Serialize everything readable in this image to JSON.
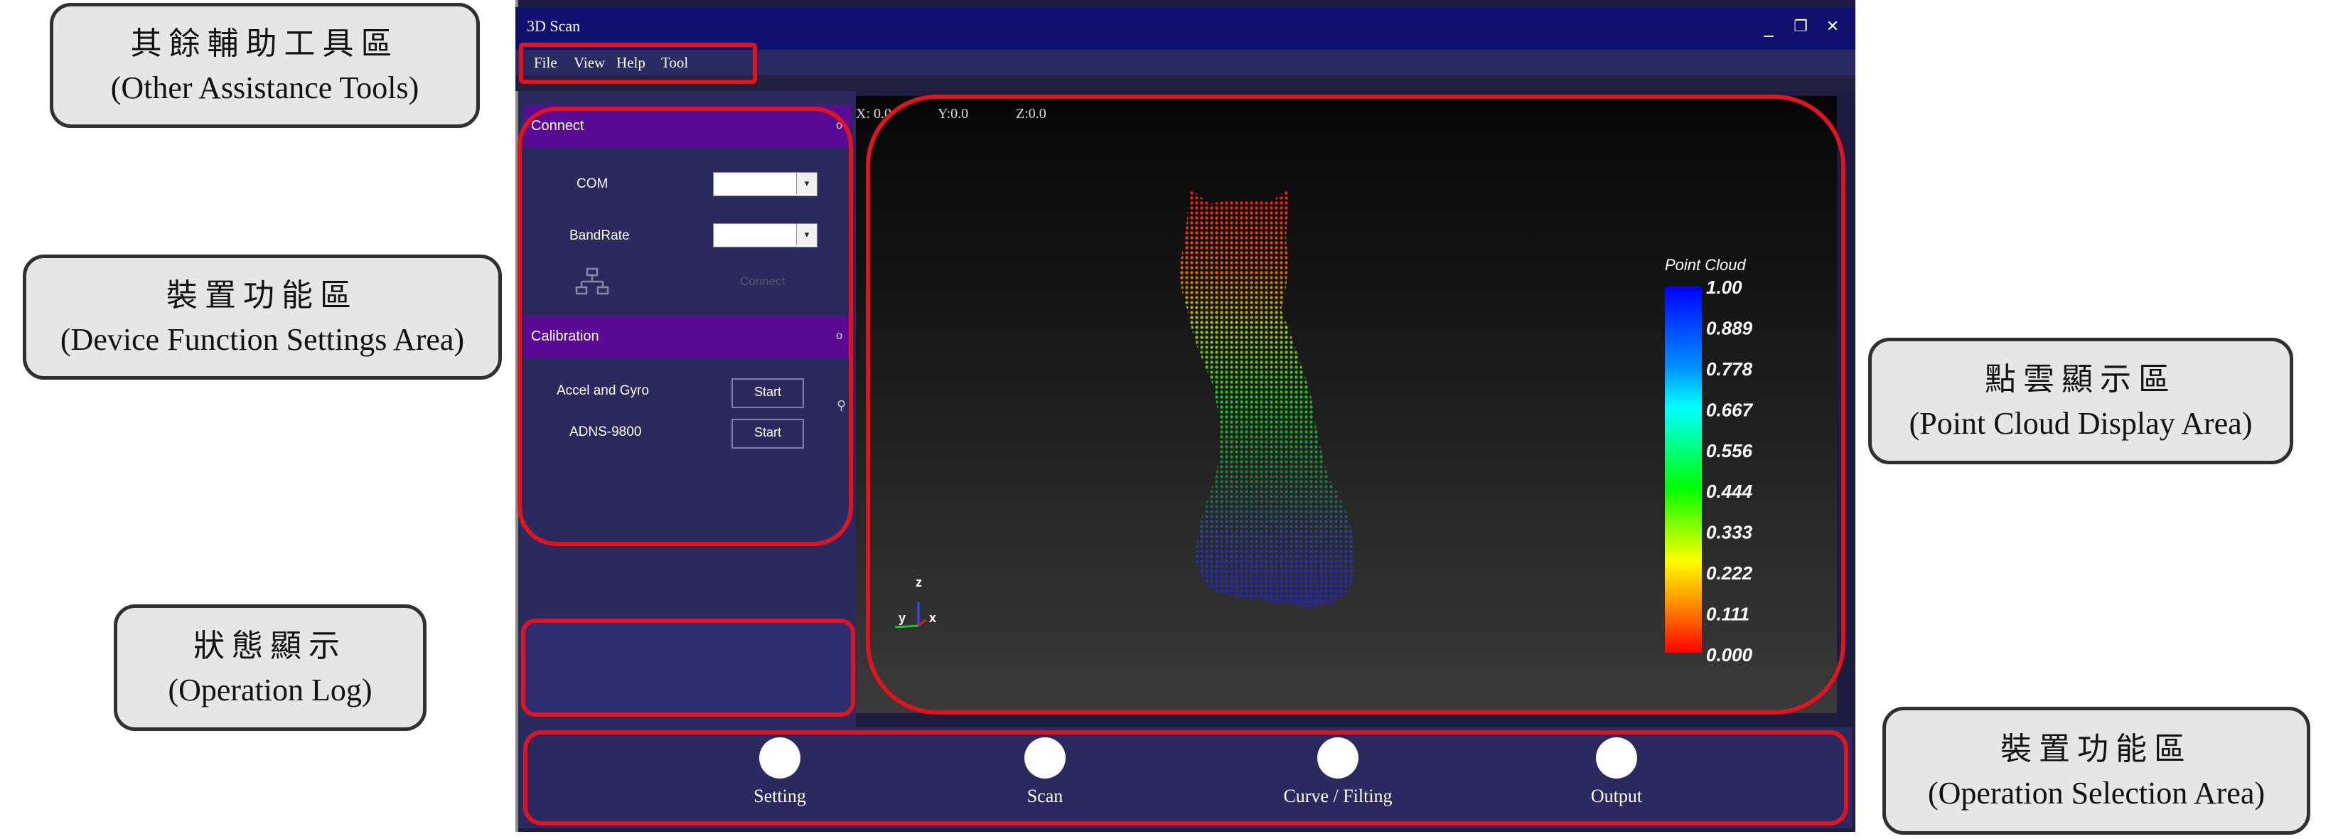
{
  "callouts": {
    "tools": {
      "zh": "其餘輔助工具區",
      "en": "(Other Assistance Tools)"
    },
    "device": {
      "zh": "裝置功能區",
      "en": "(Device Function Settings Area)"
    },
    "log": {
      "zh": "狀態顯示",
      "en": "(Operation Log)"
    },
    "pointcloud": {
      "zh": "點雲顯示區",
      "en": "(Point Cloud Display Area)"
    },
    "operation": {
      "zh": "裝置功能區",
      "en": "(Operation Selection Area)"
    }
  },
  "window": {
    "title": "3D Scan",
    "minimize": "_",
    "restore": "❐",
    "close": "✕"
  },
  "menu": [
    "File",
    "View",
    "Help",
    "Tool"
  ],
  "connect": {
    "header": "Connect",
    "com_label": "COM",
    "com_value": "",
    "bandrate_label": "BandRate",
    "bandrate_value": "",
    "connect_button": "Connect",
    "network_icon": "network-icon"
  },
  "calibration": {
    "header": "Calibration",
    "rows": [
      {
        "label": "Accel  and Gyro",
        "button": "Start"
      },
      {
        "label": "ADNS-9800",
        "button": "Start"
      }
    ]
  },
  "canvas": {
    "coords": {
      "x": "X: 0.0",
      "y": "Y:0.0",
      "z": "Z:0.0"
    },
    "legend_title": "Point Cloud",
    "legend_ticks": [
      "1.00",
      "0.889",
      "0.778",
      "0.667",
      "0.556",
      "0.444",
      "0.333",
      "0.222",
      "0.111",
      "0.000"
    ],
    "axes": {
      "x": "x",
      "y": "y",
      "z": "z"
    },
    "colors": {
      "high": "#ff0000",
      "mid": "#00ff00",
      "low": "#0000ff"
    }
  },
  "operations": [
    "Setting",
    "Scan",
    "Curve / Filting",
    "Output"
  ],
  "accent": "#e0141e"
}
